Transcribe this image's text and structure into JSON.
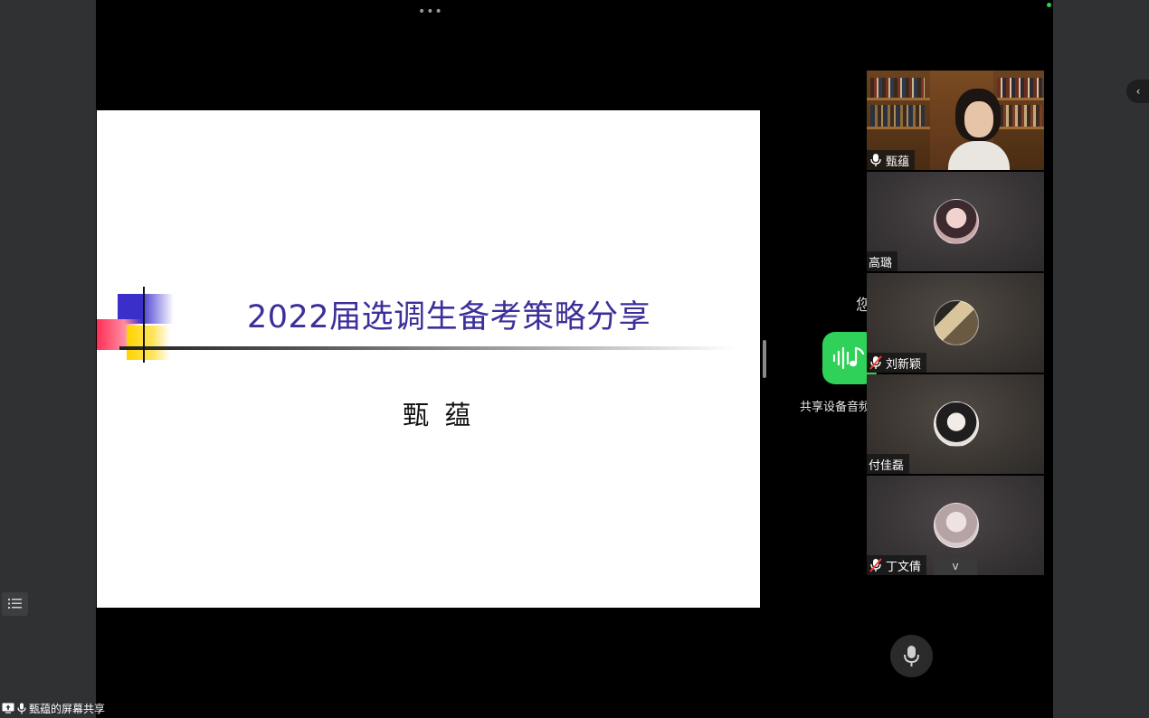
{
  "colors": {
    "stage_bg": "#000000",
    "panel_bg": "#2f3133",
    "slide_title_color": "#3b2f9a",
    "audio_green": "#2fd158",
    "status_green": "#2bd34e"
  },
  "toolbar": {
    "more_label": "•••"
  },
  "slide": {
    "title": "2022届选调生备考策略分享",
    "author": "甄 蕴"
  },
  "share_panel": {
    "partial_text": "您",
    "audio_button_icon": "sound-wave-music-icon",
    "audio_label": "共享设备音频"
  },
  "participants": [
    {
      "name": "甄蕴",
      "mic": "on",
      "video": "on"
    },
    {
      "name": "高璐",
      "mic": "none",
      "video": "off"
    },
    {
      "name": "刘新颖",
      "mic": "muted",
      "video": "off"
    },
    {
      "name": "付佳磊",
      "mic": "none",
      "video": "off"
    },
    {
      "name": "丁文倩",
      "mic": "muted",
      "video": "off"
    }
  ],
  "controls": {
    "expand_icon": "chevron-down-icon",
    "expand_label": "v",
    "mic_icon": "microphone-icon",
    "collapse_icon": "chevron-left-icon",
    "collapse_label": "‹",
    "list_icon": "list-icon"
  },
  "status": {
    "share_text": "甄蕴的屏幕共享"
  }
}
